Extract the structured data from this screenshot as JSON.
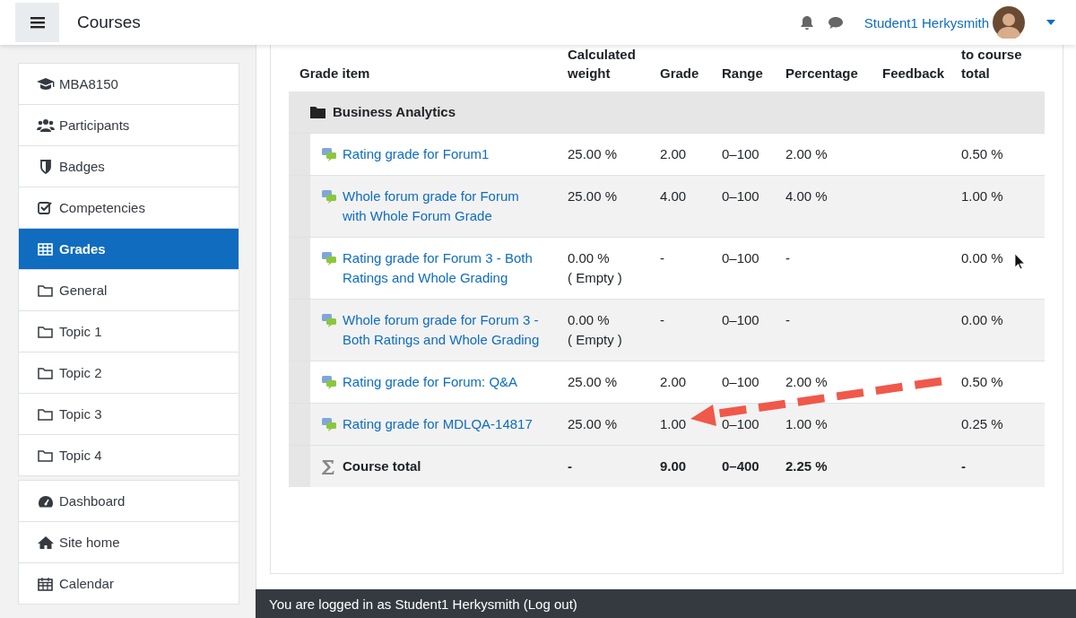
{
  "navbar": {
    "title": "Courses",
    "user_name": "Student1 Herkysmith"
  },
  "sidebar": {
    "groups": [
      [
        {
          "label": "MBA8150",
          "selected": false
        },
        {
          "label": "Participants",
          "selected": false
        },
        {
          "label": "Badges",
          "selected": false
        },
        {
          "label": "Competencies",
          "selected": false
        },
        {
          "label": "Grades",
          "selected": true
        },
        {
          "label": "General",
          "selected": false
        },
        {
          "label": "Topic 1",
          "selected": false
        },
        {
          "label": "Topic 2",
          "selected": false
        },
        {
          "label": "Topic 3",
          "selected": false
        },
        {
          "label": "Topic 4",
          "selected": false
        }
      ],
      [
        {
          "label": "Dashboard",
          "selected": false
        },
        {
          "label": "Site home",
          "selected": false
        },
        {
          "label": "Calendar",
          "selected": false
        }
      ]
    ]
  },
  "table": {
    "columns": [
      "Grade item",
      "Calculated weight",
      "Grade",
      "Range",
      "Percentage",
      "Feedback",
      "to course total"
    ],
    "category": "Business Analytics",
    "rows": [
      {
        "kind": "item",
        "name": "Rating grade for Forum1",
        "weight": "25.00 %",
        "grade": "2.00",
        "range": "0–100",
        "percentage": "2.00 %",
        "contribution": "0.50 %"
      },
      {
        "kind": "item",
        "name": "Whole forum grade for Forum with Whole Forum Grade",
        "weight": "25.00 %",
        "grade": "4.00",
        "range": "0–100",
        "percentage": "4.00 %",
        "contribution": "1.00 %"
      },
      {
        "kind": "item",
        "name": "Rating grade for Forum 3 - Both Ratings and Whole Grading",
        "weight": "0.00 %",
        "weight_note": "( Empty )",
        "grade": "-",
        "range": "0–100",
        "percentage": "-",
        "contribution": "0.00 %"
      },
      {
        "kind": "item",
        "name": "Whole forum grade for Forum 3 - Both Ratings and Whole Grading",
        "weight": "0.00 %",
        "weight_note": "( Empty )",
        "grade": "-",
        "range": "0–100",
        "percentage": "-",
        "contribution": "0.00 %"
      },
      {
        "kind": "item",
        "name": "Rating grade for Forum: Q&A",
        "weight": "25.00 %",
        "grade": "2.00",
        "range": "0–100",
        "percentage": "2.00 %",
        "contribution": "0.50 %"
      },
      {
        "kind": "item",
        "name": "Rating grade for MDLQA-14817",
        "weight": "25.00 %",
        "grade": "1.00",
        "range": "0–100",
        "percentage": "1.00 %",
        "contribution": "0.25 %"
      },
      {
        "kind": "total",
        "name": "Course total",
        "weight": "-",
        "grade": "9.00",
        "range": "0–400",
        "percentage": "2.25 %",
        "contribution": "-"
      }
    ]
  },
  "footer": {
    "text": "You are logged in as Student1 Herkysmith (Log out)"
  }
}
